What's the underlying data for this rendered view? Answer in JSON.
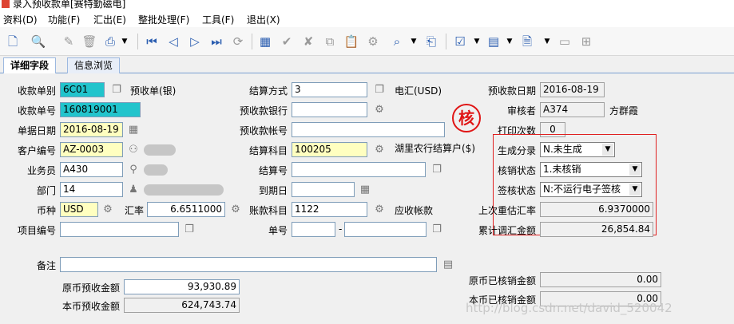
{
  "window": {
    "title": "录入预收款单[赛特勤磁电]"
  },
  "menu": [
    "资料(D)",
    "功能(F)",
    "汇出(E)",
    "整批处理(F)",
    "工具(F)",
    "退出(X)"
  ],
  "tabs": [
    "详细字段",
    "信息浏览"
  ],
  "form": {
    "receipt_type_label": "收款单别",
    "receipt_type": "6C01",
    "receipt_type_name": "预收单(银)",
    "receipt_no_label": "收款单号",
    "receipt_no": "160819001",
    "doc_date_label": "单据日期",
    "doc_date": "2016-08-19",
    "customer_no_label": "客户编号",
    "customer_no": "AZ-0003",
    "salesman_label": "业务员",
    "salesman": "A430",
    "dept_label": "部门",
    "dept": "14",
    "currency_label": "币种",
    "currency": "USD",
    "rate_label": "汇率",
    "rate": "6.6511000",
    "project_no_label": "项目编号",
    "project_no": "",
    "settle_method_label": "结算方式",
    "settle_method": "3",
    "settle_method_name": "电汇(USD)",
    "bank_label": "预收款银行",
    "bank": "",
    "account_label": "预收款帐号",
    "account": "",
    "settle_subject_label": "结算科目",
    "settle_subject": "100205",
    "settle_subject_name": "湖里农行结算户($)",
    "settle_no_label": "结算号",
    "settle_no": "",
    "due_date_label": "到期日",
    "due_date": "",
    "ledger_subject_label": "账款科目",
    "ledger_subject": "1122",
    "ledger_subject_name": "应收帐款",
    "single_no_label": "单号",
    "single_no_a": "",
    "single_no_sep": "-",
    "single_no_b": "",
    "prepay_date_label": "预收款日期",
    "prepay_date": "2016-08-19",
    "auditor_label": "审核者",
    "auditor": "A374",
    "auditor_name": "方群霞",
    "print_count_label": "打印次数",
    "print_count": "0",
    "gen_class_label": "生成分录",
    "gen_class": "N.未生成",
    "audit_status_label": "核销状态",
    "audit_status": "1.未核销",
    "sign_status_label": "签核状态",
    "sign_status": "N:不运行电子签核",
    "last_rate_label": "上次重估汇率",
    "last_rate": "6.9370000",
    "adjust_amount_label": "累计调汇金额",
    "adjust_amount": "26,854.84",
    "remark_label": "备注",
    "remark": "",
    "orig_prepay_label": "原币预收金额",
    "orig_prepay": "93,930.89",
    "local_prepay_label": "本币预收金额",
    "local_prepay": "624,743.74",
    "orig_settled_label": "原币已核销金额",
    "orig_settled": "0.00",
    "local_settled_label": "本币已核销金额",
    "local_settled": "0.00"
  },
  "stamp_text": "核",
  "watermark": "http://blog.csdn.net/david_520042"
}
